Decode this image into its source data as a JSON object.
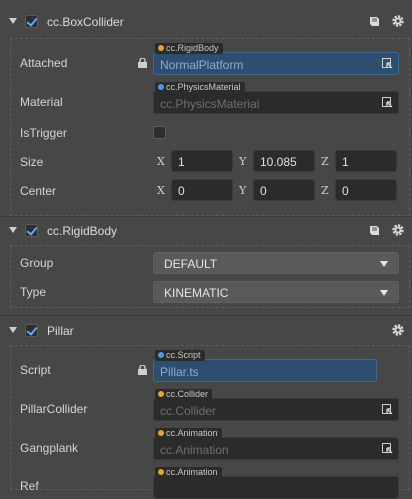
{
  "box_collider": {
    "title": "cc.BoxCollider",
    "enabled": true,
    "attached": {
      "label": "Attached",
      "type_tag": "cc.RigidBody",
      "value": "NormalPlatform"
    },
    "material": {
      "label": "Material",
      "type_tag": "cc.PhysicsMaterial",
      "value": "cc.PhysicsMaterial"
    },
    "is_trigger": {
      "label": "IsTrigger",
      "checked": false
    },
    "size": {
      "label": "Size",
      "x": "1",
      "y": "10.085",
      "z": "1"
    },
    "center": {
      "label": "Center",
      "x": "0",
      "y": "0",
      "z": "0"
    }
  },
  "axis_labels": {
    "x": "X",
    "y": "Y",
    "z": "Z"
  },
  "rigid_body": {
    "title": "cc.RigidBody",
    "enabled": true,
    "group": {
      "label": "Group",
      "value": "DEFAULT"
    },
    "type": {
      "label": "Type",
      "value": "KINEMATIC"
    }
  },
  "pillar": {
    "title": "Pillar",
    "enabled": true,
    "script": {
      "label": "Script",
      "type_tag": "cc.Script",
      "value": "Pillar.ts"
    },
    "pillar_collider": {
      "label": "PillarCollider",
      "type_tag": "cc.Collider",
      "value": "cc.Collider"
    },
    "gangplank": {
      "label": "Gangplank",
      "type_tag": "cc.Animation",
      "value": "cc.Animation"
    },
    "next": {
      "label": "Ref",
      "type_tag": "cc.Animation"
    }
  },
  "colors": {
    "accent": "#5aa8ff",
    "tag_dot_orange": "#e6a32d",
    "tag_dot_blue": "#4e9ae8",
    "panel": "#474747"
  }
}
